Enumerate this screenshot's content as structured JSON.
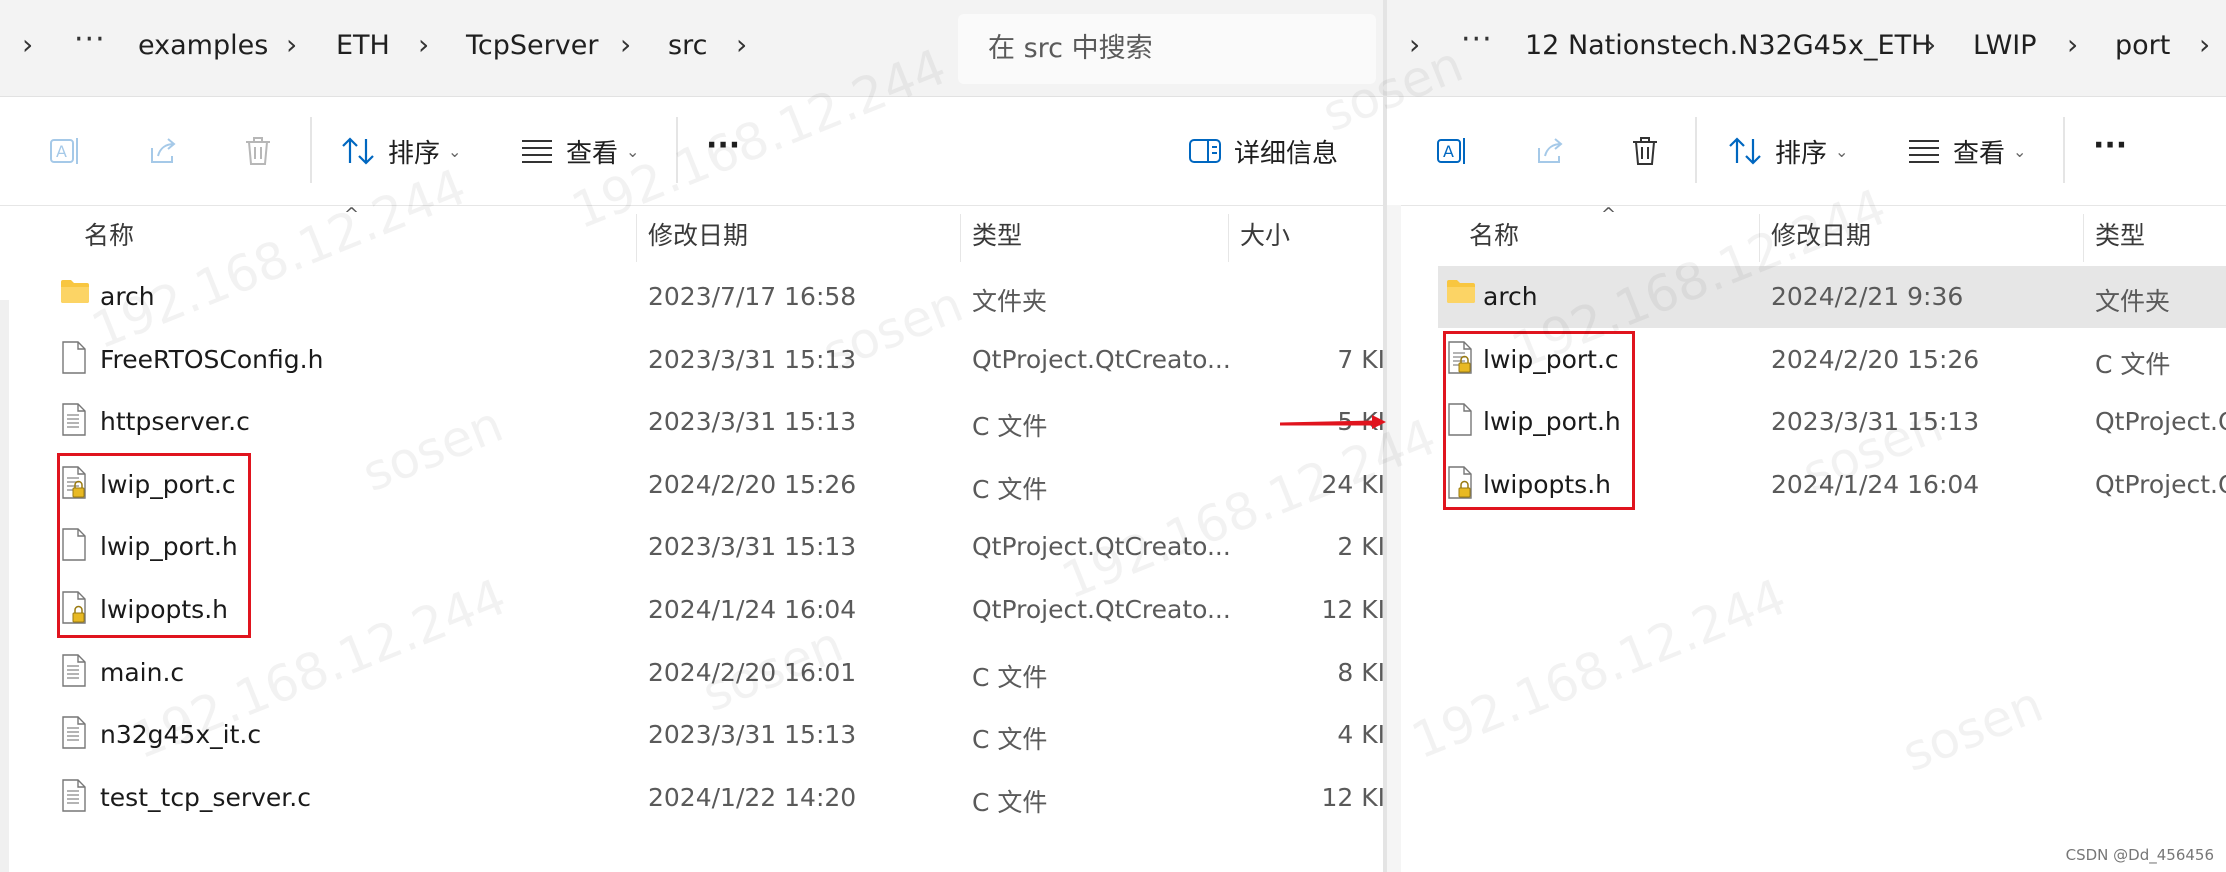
{
  "left": {
    "breadcrumb": [
      "examples",
      "ETH",
      "TcpServer",
      "src"
    ],
    "overflow": "···",
    "search_placeholder": "在 src 中搜索",
    "toolbar": {
      "sort": "排序",
      "view": "查看",
      "more": "···",
      "details": "详细信息"
    },
    "columns": {
      "name": "名称",
      "date": "修改日期",
      "type": "类型",
      "size": "大小"
    },
    "files": [
      {
        "name": "arch",
        "date": "2023/7/17 16:58",
        "type": "文件夹",
        "size": "",
        "icon": "folder-icon"
      },
      {
        "name": "FreeRTOSConfig.h",
        "date": "2023/3/31 15:13",
        "type": "QtProject.QtCreato...",
        "size": "7 KI",
        "icon": "file-icon"
      },
      {
        "name": "httpserver.c",
        "date": "2023/3/31 15:13",
        "type": "C 文件",
        "size": "5 KI",
        "icon": "c-file-icon"
      },
      {
        "name": "lwip_port.c",
        "date": "2024/2/20 15:26",
        "type": "C 文件",
        "size": "24 KI",
        "icon": "locked-c-file-icon"
      },
      {
        "name": "lwip_port.h",
        "date": "2023/3/31 15:13",
        "type": "QtProject.QtCreato...",
        "size": "2 KI",
        "icon": "file-icon"
      },
      {
        "name": "lwipopts.h",
        "date": "2024/1/24 16:04",
        "type": "QtProject.QtCreato...",
        "size": "12 KI",
        "icon": "locked-file-icon"
      },
      {
        "name": "main.c",
        "date": "2024/2/20 16:01",
        "type": "C 文件",
        "size": "8 KI",
        "icon": "c-file-icon"
      },
      {
        "name": "n32g45x_it.c",
        "date": "2023/3/31 15:13",
        "type": "C 文件",
        "size": "4 KI",
        "icon": "c-file-icon"
      },
      {
        "name": "test_tcp_server.c",
        "date": "2024/1/22 14:20",
        "type": "C 文件",
        "size": "12 KI",
        "icon": "c-file-icon"
      }
    ]
  },
  "right": {
    "breadcrumb": [
      "12 Nationstech.N32G45x_ETH",
      "LWIP",
      "port"
    ],
    "overflow": "···",
    "toolbar": {
      "sort": "排序",
      "view": "查看",
      "more": "···"
    },
    "columns": {
      "name": "名称",
      "date": "修改日期",
      "type": "类型"
    },
    "files": [
      {
        "name": "arch",
        "date": "2024/2/21 9:36",
        "type": "文件夹",
        "icon": "folder-icon",
        "selected": true
      },
      {
        "name": "lwip_port.c",
        "date": "2024/2/20 15:26",
        "type": "C 文件",
        "icon": "locked-c-file-icon"
      },
      {
        "name": "lwip_port.h",
        "date": "2023/3/31 15:13",
        "type": "QtProject.Q",
        "icon": "file-icon"
      },
      {
        "name": "lwipopts.h",
        "date": "2024/1/24 16:04",
        "type": "QtProject.Q",
        "icon": "locked-file-icon"
      }
    ]
  },
  "watermark": "192.168.12.244",
  "watermark2": "sosen",
  "credit": "CSDN @Dd_456456",
  "colors": {
    "highlight": "#e0141e",
    "accent": "#0067c0",
    "folder": "#f8c640"
  }
}
